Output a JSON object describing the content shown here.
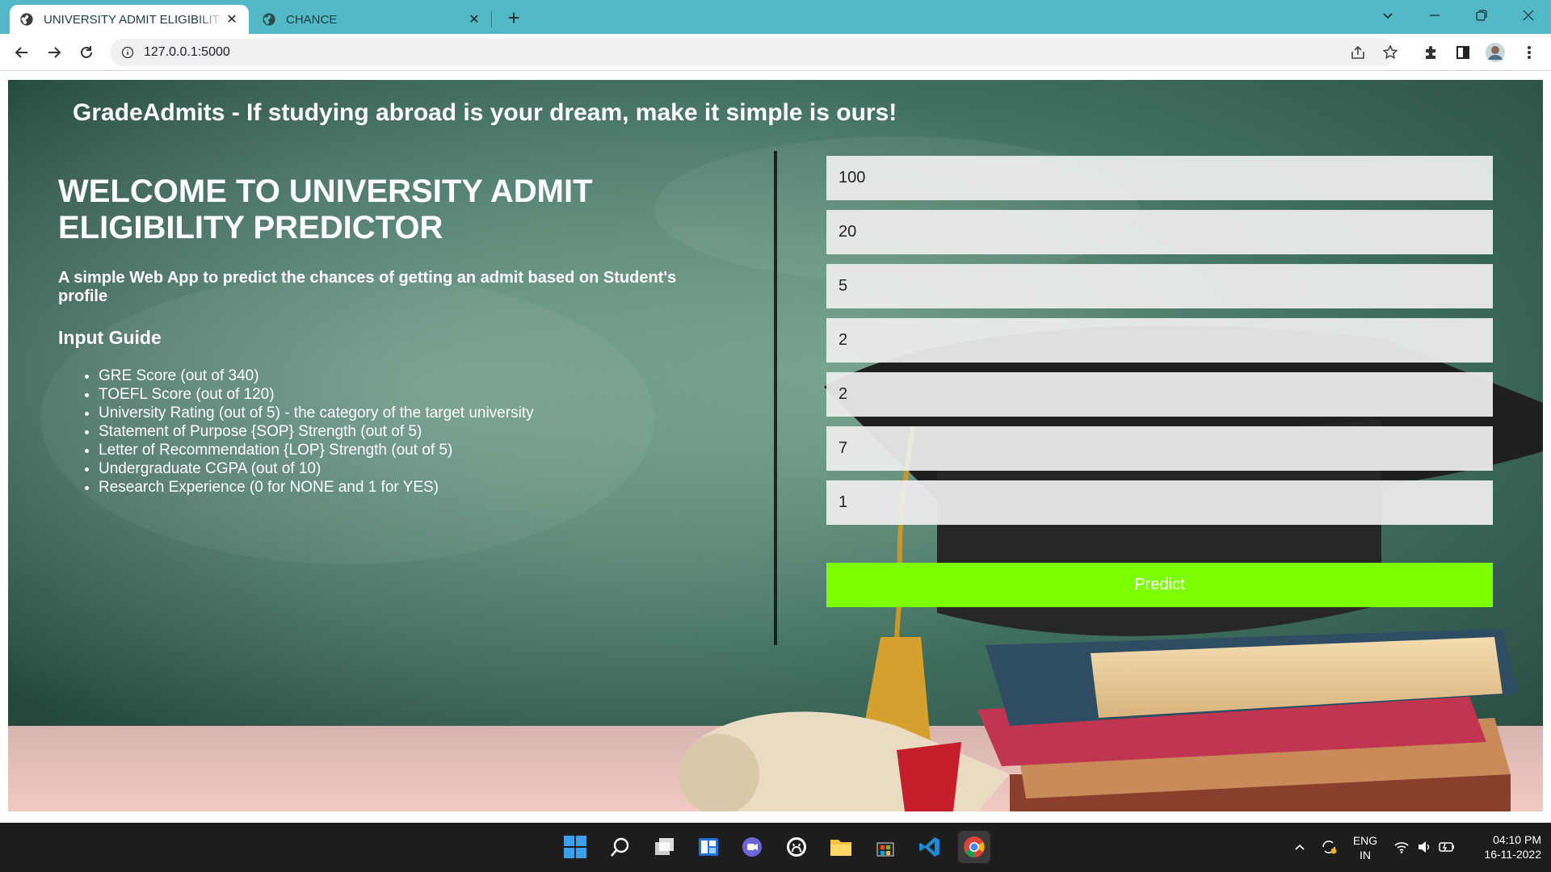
{
  "browser": {
    "tabs": [
      {
        "title": "UNIVERSITY ADMIT ELIGIBILITY PREDICTOR",
        "active": true
      },
      {
        "title": "CHANCE",
        "active": false
      }
    ],
    "new_tab_label": "+",
    "url": "127.0.0.1:5000"
  },
  "page": {
    "brand": "GradeAdmits - If studying abroad is your dream, make it simple is ours!",
    "welcome_title": "WELCOME TO UNIVERSITY ADMIT ELIGIBILITY PREDICTOR",
    "tagline": "A simple Web App to predict the chances of getting an admit based on Student's profile",
    "guide_title": "Input Guide",
    "guide_items": [
      "GRE Score (out of 340)",
      "TOEFL Score (out of 120)",
      "University Rating (out of 5) - the category of the target university",
      "Statement of Purpose {SOP} Strength (out of 5)",
      "Letter of Recommendation {LOP} Strength (out of 5)",
      "Undergraduate CGPA (out of 10)",
      "Research Experience (0 for NONE and 1 for YES)"
    ],
    "fields": [
      {
        "value": "100"
      },
      {
        "value": "20"
      },
      {
        "value": "5"
      },
      {
        "value": "2"
      },
      {
        "value": "2"
      },
      {
        "value": "7"
      },
      {
        "value": "1"
      }
    ],
    "predict_label": "Predict",
    "predict_color": "#7cff00"
  },
  "taskbar": {
    "lang_top": "ENG",
    "lang_bottom": "IN",
    "time": "04:10 PM",
    "date": "16-11-2022"
  },
  "colors": {
    "tabbar": "#52b8c6",
    "taskbar": "#1d1d1d"
  }
}
